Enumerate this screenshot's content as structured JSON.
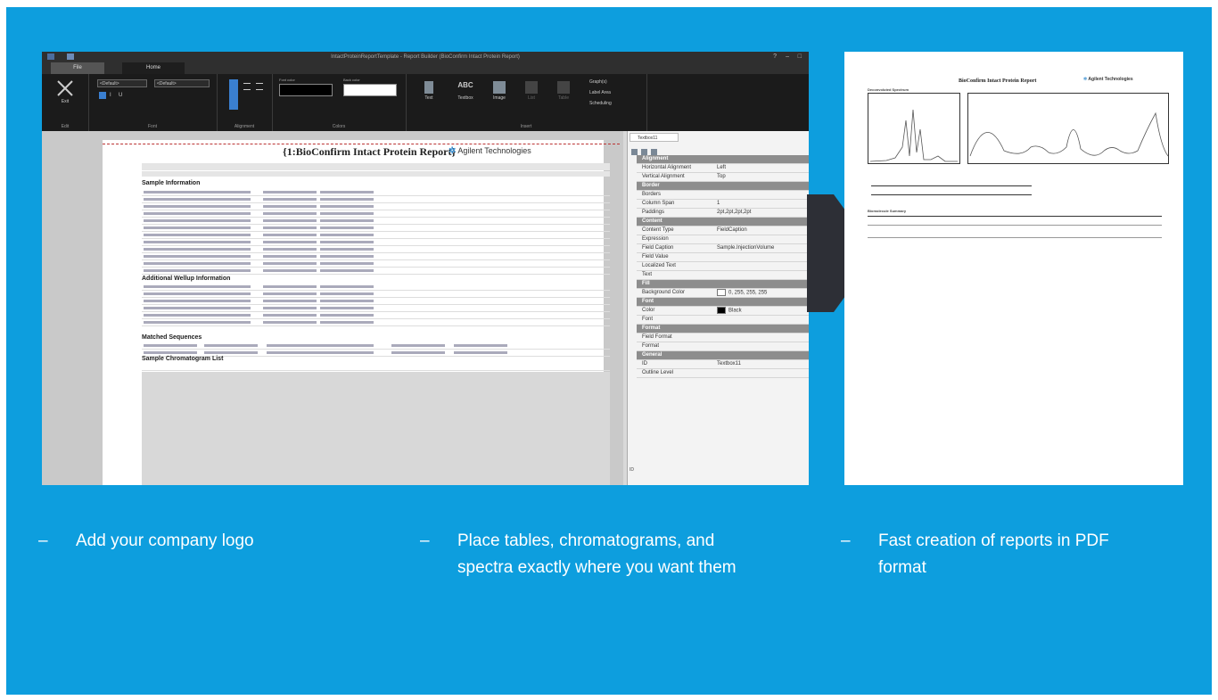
{
  "colors": {
    "background": "#0d9ede",
    "arrow": "#2d2f36",
    "caption": "#ffffff"
  },
  "window": {
    "title": "IntactProteinReportTemplate - Report Builder (BioConfirm Intact Protein Report)",
    "tabs": [
      "File",
      "Home"
    ],
    "ribbon": {
      "groups": [
        "Edit",
        "Font",
        "Alignment",
        "Colors",
        "Insert"
      ],
      "exit_label": "Exit",
      "font_family": "<Default>",
      "font_size": "<Default>",
      "font_color_label": "Font color",
      "back_color_label": "Back color",
      "insert_items": [
        "Text",
        "Textbox",
        "Image",
        "List",
        "Table"
      ],
      "insert_side": [
        "Graph(s)",
        "Label Area",
        "Scheduling"
      ]
    },
    "report": {
      "title": "{1:BioConfirm Intact Protein Report}",
      "logo": "Agilent Technologies",
      "sections": [
        "Sample Information",
        "Additional Wellup Information",
        "Matched Sequences",
        "Sample Chromatogram List"
      ]
    },
    "properties": {
      "tab": "Textbox11",
      "rows": [
        {
          "cat": "Alignment"
        },
        {
          "k": "Horizontal Alignment",
          "v": "Left"
        },
        {
          "k": "Vertical Alignment",
          "v": "Top"
        },
        {
          "cat": "Border"
        },
        {
          "k": "Borders",
          "v": ""
        },
        {
          "k": "Column Span",
          "v": "1"
        },
        {
          "k": "Paddings",
          "v": "2pt,2pt,2pt,2pt"
        },
        {
          "cat": "Content"
        },
        {
          "k": "Content Type",
          "v": "FieldCaption"
        },
        {
          "k": "Expression",
          "v": ""
        },
        {
          "k": "Field Caption",
          "v": "Sample.InjectionVolume"
        },
        {
          "k": "Field Value",
          "v": ""
        },
        {
          "k": "Localized Text",
          "v": ""
        },
        {
          "k": "Text",
          "v": ""
        },
        {
          "cat": "Fill"
        },
        {
          "k": "Background Color",
          "v": "0, 255, 255, 255",
          "swatch": "#ffffff"
        },
        {
          "cat": "Font"
        },
        {
          "k": "Color",
          "v": "Black",
          "swatch": "#000000"
        },
        {
          "k": "Font",
          "v": ""
        },
        {
          "cat": "Format"
        },
        {
          "k": "Field Format",
          "v": ""
        },
        {
          "k": "Format",
          "v": ""
        },
        {
          "cat": "General"
        },
        {
          "k": "ID",
          "v": "Textbox11"
        },
        {
          "k": "Outline Level",
          "v": ""
        }
      ]
    }
  },
  "pdf": {
    "title": "BioConfirm Intact Protein Report",
    "brand": "Agilent Technologies",
    "plot_labels": [
      "Deconvoluted Spectrum",
      "Biomolecule Summary"
    ]
  },
  "captions": [
    {
      "dash": "–",
      "text": "Add your company logo"
    },
    {
      "dash": "–",
      "text": "Place tables, chromatograms, and spectra exactly where you want them"
    },
    {
      "dash": "–",
      "text": "Fast creation of reports in PDF format"
    }
  ]
}
